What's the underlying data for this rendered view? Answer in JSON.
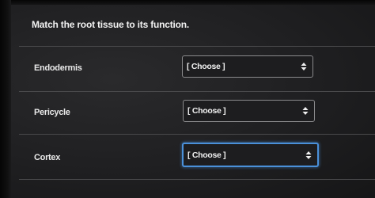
{
  "question": "Match the root tissue to its function.",
  "rows": [
    {
      "label": "Endodermis",
      "selected": "[ Choose ]"
    },
    {
      "label": "Pericycle",
      "selected": "[ Choose ]"
    },
    {
      "label": "Cortex",
      "selected": "[ Choose ]"
    }
  ],
  "icons": {
    "select_arrow": "updown-arrow-icon"
  },
  "colors": {
    "focus_ring": "#4a90d9",
    "background": "#1f1f21",
    "text": "#f0f0f0"
  }
}
